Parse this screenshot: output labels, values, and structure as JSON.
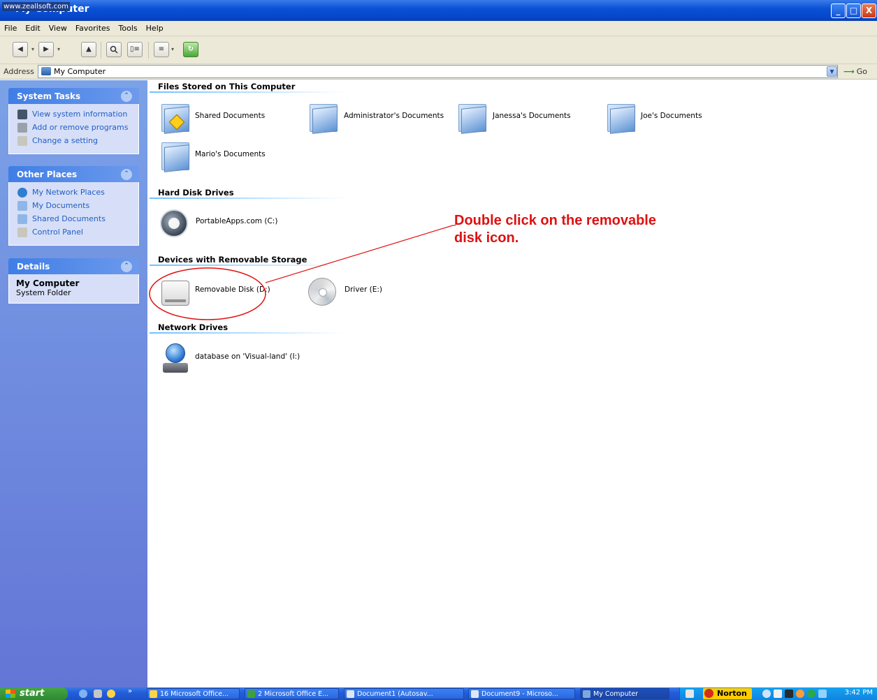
{
  "window": {
    "title": "My Computer",
    "watermark": "www.zeallsoft.com",
    "controls": [
      "_",
      "□",
      "X"
    ]
  },
  "menu": [
    "File",
    "Edit",
    "View",
    "Favorites",
    "Tools",
    "Help"
  ],
  "address": {
    "label": "Address",
    "value": "My Computer",
    "go_label": "Go"
  },
  "taskpane": {
    "system_tasks": {
      "title": "System Tasks",
      "items": [
        "View system information",
        "Add or remove programs",
        "Change a setting"
      ]
    },
    "other_places": {
      "title": "Other Places",
      "items": [
        "My Network Places",
        "My Documents",
        "Shared Documents",
        "Control Panel"
      ]
    },
    "details": {
      "title": "Details",
      "name": "My Computer",
      "type": "System Folder"
    }
  },
  "sections": {
    "files": {
      "title": "Files Stored on This Computer",
      "items": [
        "Shared Documents",
        "Administrator's Documents",
        "Janessa's Documents",
        "Joe's Documents",
        "Mario's Documents"
      ]
    },
    "hdd": {
      "title": "Hard Disk Drives",
      "items": [
        "PortableApps.com (C:)"
      ]
    },
    "removable": {
      "title": "Devices with Removable Storage",
      "items": [
        "Removable Disk (D:)",
        "Driver (E:)"
      ]
    },
    "network": {
      "title": "Network Drives",
      "items": [
        "database on 'Visual-land' (I:)"
      ]
    }
  },
  "annotation": {
    "line1": "Double click on the removable",
    "line2": "disk icon.",
    "color": "#e01010"
  },
  "taskbar": {
    "start": "start",
    "tasks": [
      "16 Microsoft Office...",
      "2 Microsoft Office E...",
      "Document1 (Autosav...",
      "Document9 - Microso...",
      "My Computer"
    ],
    "norton": "Norton",
    "clock": "3:42 PM"
  },
  "colors": {
    "xp_blue": "#0545c9",
    "taskpane": "#6d8ee0",
    "link": "#215dc6"
  }
}
